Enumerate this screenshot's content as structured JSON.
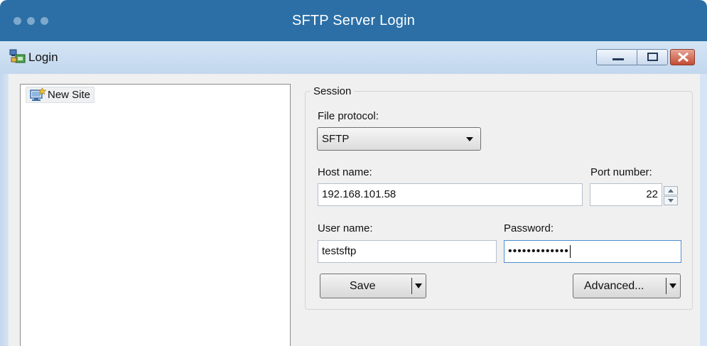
{
  "app": {
    "title": "SFTP Server Login",
    "colors": {
      "header": "#2b6fa6",
      "title_text": "#ffffff"
    }
  },
  "window": {
    "title": "Login",
    "icon": "login-sites-icon",
    "controls": [
      "minimize-icon",
      "maximize-icon",
      "close-icon"
    ]
  },
  "sites": {
    "items": [
      {
        "label": "New Site",
        "icon": "new-site-computer-icon"
      }
    ]
  },
  "session": {
    "group_label": "Session",
    "file_protocol": {
      "label": "File protocol:",
      "value": "SFTP"
    },
    "host_name": {
      "label": "Host name:",
      "value": "192.168.101.58"
    },
    "port_number": {
      "label": "Port number:",
      "value": "22"
    },
    "user_name": {
      "label": "User name:",
      "value": "testsftp"
    },
    "password": {
      "label": "Password:",
      "masked_value": "•••••••••••••"
    },
    "save_button": "Save",
    "advanced_button": "Advanced..."
  }
}
